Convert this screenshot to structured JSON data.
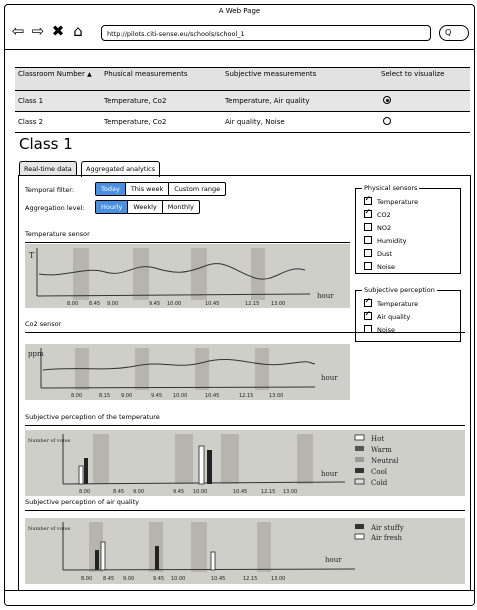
{
  "window": {
    "title": "A Web Page"
  },
  "browser": {
    "url": "http://pilots.citi-sense.eu/schools/school_1",
    "search_glyph": "Q"
  },
  "classrooms": {
    "headers": [
      "Classroom Number",
      "Phusical measurements",
      "Subjective measurements",
      "Select to visualize"
    ],
    "rows": [
      {
        "name": "Class 1",
        "physical": "Temperature, Co2",
        "subjective": "Temperature, Air quality",
        "selected": true
      },
      {
        "name": "Class 2",
        "physical": "Temperature, Co2",
        "subjective": "Air quality, Noise",
        "selected": false
      }
    ]
  },
  "page": {
    "title": "Class 1"
  },
  "tabs": [
    {
      "label": "Real-time data",
      "active": false
    },
    {
      "label": "Aggregated analytics",
      "active": true
    }
  ],
  "filters": {
    "temporal_label": "Temporal filter:",
    "temporal_options": [
      "Today",
      "This week",
      "Custom range"
    ],
    "temporal_selected": "Today",
    "aggregation_label": "Aggregation level:",
    "aggregation_options": [
      "Hourly",
      "Weekly",
      "Monthly"
    ],
    "aggregation_selected": "Hourly"
  },
  "sections": {
    "temperature": "Temperature sensor",
    "co2": "Co2 sensor",
    "subj_temp": "Subjective perception of the temperature",
    "subj_air": "Subjective perception of air quality"
  },
  "physical_sensors": {
    "title": "Physical sensors",
    "items": [
      {
        "label": "Temperature",
        "checked": true
      },
      {
        "label": "CO2",
        "checked": true
      },
      {
        "label": "NO2",
        "checked": false
      },
      {
        "label": "Humidity",
        "checked": false
      },
      {
        "label": "Dust",
        "checked": false
      },
      {
        "label": "Noise",
        "checked": false
      }
    ]
  },
  "subjective_perception": {
    "title": "Subjective perception",
    "items": [
      {
        "label": "Temperature",
        "checked": true
      },
      {
        "label": "Air quality",
        "checked": true
      },
      {
        "label": "Noise",
        "checked": false
      }
    ]
  },
  "sketch_text": {
    "temp_y": "T",
    "temp_x": "hour",
    "temp_ticks": [
      "8.00",
      "8.45",
      "9.00",
      "9.45",
      "10.00",
      "10.45",
      "12.15",
      "13.00"
    ],
    "co2_y": "ppm",
    "co2_x": "hour",
    "co2_ticks": [
      "8.00",
      "8.15",
      "9.00",
      "9.45",
      "10.00",
      "10.45",
      "12.15",
      "13.00"
    ],
    "subj_temp_y": "Number of votes",
    "subj_temp_x": "hour",
    "subj_temp_ticks": [
      "8.00",
      "8.45",
      "9.00",
      "9.45",
      "10.00",
      "10.45",
      "12.15",
      "13.00"
    ],
    "subj_temp_legend": [
      "Hot",
      "Warm",
      "Neutral",
      "Cool",
      "Cold"
    ],
    "subj_air_y": "Number of votes",
    "subj_air_x": "hour",
    "subj_air_ticks": [
      "8.00",
      "8.45",
      "9.00",
      "9.45",
      "10.00",
      "10.45",
      "12.15",
      "13.00"
    ],
    "subj_air_legend": [
      "Air stuffy",
      "Air fresh"
    ]
  }
}
